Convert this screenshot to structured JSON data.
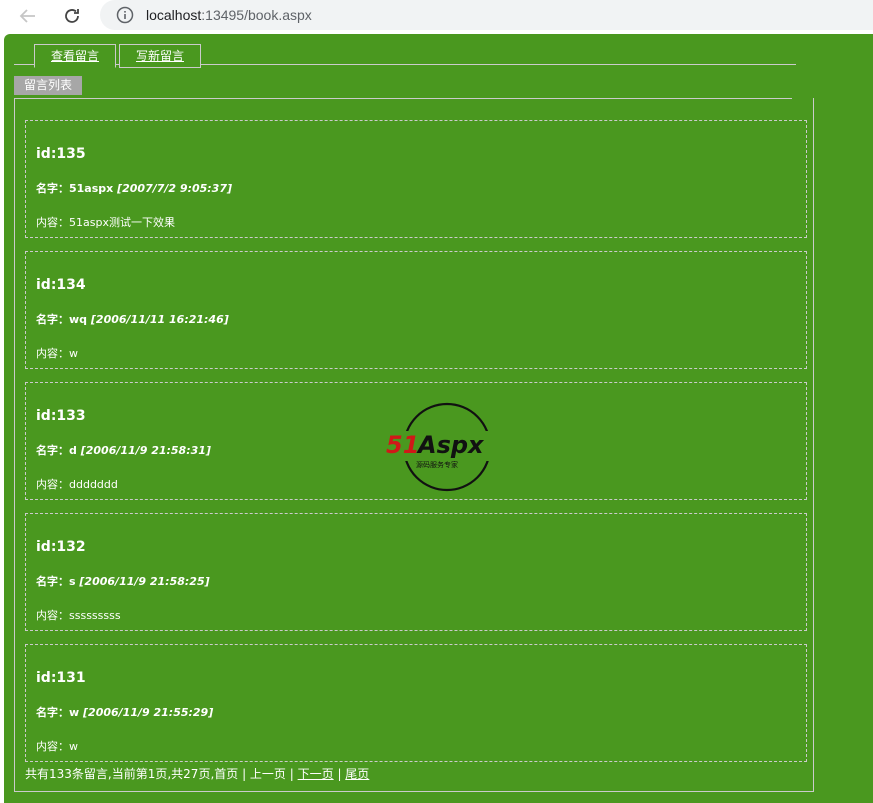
{
  "browser": {
    "url_host": "localhost",
    "url_path": ":13495/book.aspx"
  },
  "tabs": [
    {
      "label": "查看留言"
    },
    {
      "label": "写新留言"
    }
  ],
  "list_title": "留言列表",
  "entries": [
    {
      "id": "id:135",
      "name_label": "名字：",
      "name": "51aspx",
      "time": "[2007/7/2 9:05:37]",
      "content_label": "内容：",
      "content": "51aspx测试一下效果"
    },
    {
      "id": "id:134",
      "name_label": "名字：",
      "name": "wq",
      "time": "[2006/11/11 16:21:46]",
      "content_label": "内容：",
      "content": "w"
    },
    {
      "id": "id:133",
      "name_label": "名字：",
      "name": "d",
      "time": "[2006/11/9 21:58:31]",
      "content_label": "内容：",
      "content": "ddddddd"
    },
    {
      "id": "id:132",
      "name_label": "名字：",
      "name": "s",
      "time": "[2006/11/9 21:58:25]",
      "content_label": "内容：",
      "content": "sssssssss"
    },
    {
      "id": "id:131",
      "name_label": "名字：",
      "name": "w",
      "time": "[2006/11/9 21:55:29]",
      "content_label": "内容：",
      "content": "w"
    }
  ],
  "pager": {
    "summary": "共有133条留言,当前第1页,共27页,首页 | 上一页 | ",
    "next": "下一页",
    "sep": " | ",
    "last": "尾页"
  },
  "watermark": {
    "logo_text": "51Aspx",
    "slogan": "源码服务专家"
  },
  "colors": {
    "page_bg": "#4a981f",
    "text": "#ffffff",
    "border": "#cbcbcb",
    "list_title_bg": "#a7a7a7"
  }
}
